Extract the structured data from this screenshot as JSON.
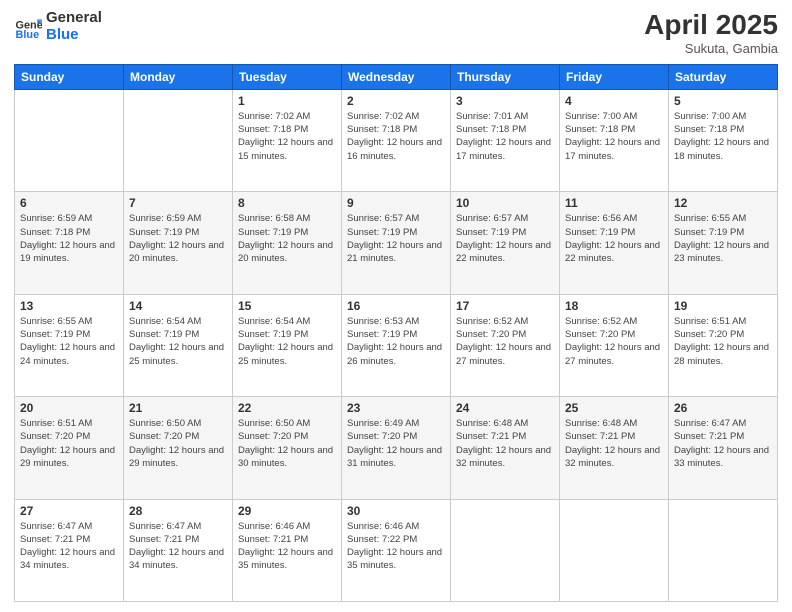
{
  "header": {
    "logo_general": "General",
    "logo_blue": "Blue",
    "month": "April 2025",
    "location": "Sukuta, Gambia"
  },
  "days_of_week": [
    "Sunday",
    "Monday",
    "Tuesday",
    "Wednesday",
    "Thursday",
    "Friday",
    "Saturday"
  ],
  "weeks": [
    [
      {
        "num": "",
        "info": ""
      },
      {
        "num": "",
        "info": ""
      },
      {
        "num": "1",
        "info": "Sunrise: 7:02 AM\nSunset: 7:18 PM\nDaylight: 12 hours and 15 minutes."
      },
      {
        "num": "2",
        "info": "Sunrise: 7:02 AM\nSunset: 7:18 PM\nDaylight: 12 hours and 16 minutes."
      },
      {
        "num": "3",
        "info": "Sunrise: 7:01 AM\nSunset: 7:18 PM\nDaylight: 12 hours and 17 minutes."
      },
      {
        "num": "4",
        "info": "Sunrise: 7:00 AM\nSunset: 7:18 PM\nDaylight: 12 hours and 17 minutes."
      },
      {
        "num": "5",
        "info": "Sunrise: 7:00 AM\nSunset: 7:18 PM\nDaylight: 12 hours and 18 minutes."
      }
    ],
    [
      {
        "num": "6",
        "info": "Sunrise: 6:59 AM\nSunset: 7:18 PM\nDaylight: 12 hours and 19 minutes."
      },
      {
        "num": "7",
        "info": "Sunrise: 6:59 AM\nSunset: 7:19 PM\nDaylight: 12 hours and 20 minutes."
      },
      {
        "num": "8",
        "info": "Sunrise: 6:58 AM\nSunset: 7:19 PM\nDaylight: 12 hours and 20 minutes."
      },
      {
        "num": "9",
        "info": "Sunrise: 6:57 AM\nSunset: 7:19 PM\nDaylight: 12 hours and 21 minutes."
      },
      {
        "num": "10",
        "info": "Sunrise: 6:57 AM\nSunset: 7:19 PM\nDaylight: 12 hours and 22 minutes."
      },
      {
        "num": "11",
        "info": "Sunrise: 6:56 AM\nSunset: 7:19 PM\nDaylight: 12 hours and 22 minutes."
      },
      {
        "num": "12",
        "info": "Sunrise: 6:55 AM\nSunset: 7:19 PM\nDaylight: 12 hours and 23 minutes."
      }
    ],
    [
      {
        "num": "13",
        "info": "Sunrise: 6:55 AM\nSunset: 7:19 PM\nDaylight: 12 hours and 24 minutes."
      },
      {
        "num": "14",
        "info": "Sunrise: 6:54 AM\nSunset: 7:19 PM\nDaylight: 12 hours and 25 minutes."
      },
      {
        "num": "15",
        "info": "Sunrise: 6:54 AM\nSunset: 7:19 PM\nDaylight: 12 hours and 25 minutes."
      },
      {
        "num": "16",
        "info": "Sunrise: 6:53 AM\nSunset: 7:19 PM\nDaylight: 12 hours and 26 minutes."
      },
      {
        "num": "17",
        "info": "Sunrise: 6:52 AM\nSunset: 7:20 PM\nDaylight: 12 hours and 27 minutes."
      },
      {
        "num": "18",
        "info": "Sunrise: 6:52 AM\nSunset: 7:20 PM\nDaylight: 12 hours and 27 minutes."
      },
      {
        "num": "19",
        "info": "Sunrise: 6:51 AM\nSunset: 7:20 PM\nDaylight: 12 hours and 28 minutes."
      }
    ],
    [
      {
        "num": "20",
        "info": "Sunrise: 6:51 AM\nSunset: 7:20 PM\nDaylight: 12 hours and 29 minutes."
      },
      {
        "num": "21",
        "info": "Sunrise: 6:50 AM\nSunset: 7:20 PM\nDaylight: 12 hours and 29 minutes."
      },
      {
        "num": "22",
        "info": "Sunrise: 6:50 AM\nSunset: 7:20 PM\nDaylight: 12 hours and 30 minutes."
      },
      {
        "num": "23",
        "info": "Sunrise: 6:49 AM\nSunset: 7:20 PM\nDaylight: 12 hours and 31 minutes."
      },
      {
        "num": "24",
        "info": "Sunrise: 6:48 AM\nSunset: 7:21 PM\nDaylight: 12 hours and 32 minutes."
      },
      {
        "num": "25",
        "info": "Sunrise: 6:48 AM\nSunset: 7:21 PM\nDaylight: 12 hours and 32 minutes."
      },
      {
        "num": "26",
        "info": "Sunrise: 6:47 AM\nSunset: 7:21 PM\nDaylight: 12 hours and 33 minutes."
      }
    ],
    [
      {
        "num": "27",
        "info": "Sunrise: 6:47 AM\nSunset: 7:21 PM\nDaylight: 12 hours and 34 minutes."
      },
      {
        "num": "28",
        "info": "Sunrise: 6:47 AM\nSunset: 7:21 PM\nDaylight: 12 hours and 34 minutes."
      },
      {
        "num": "29",
        "info": "Sunrise: 6:46 AM\nSunset: 7:21 PM\nDaylight: 12 hours and 35 minutes."
      },
      {
        "num": "30",
        "info": "Sunrise: 6:46 AM\nSunset: 7:22 PM\nDaylight: 12 hours and 35 minutes."
      },
      {
        "num": "",
        "info": ""
      },
      {
        "num": "",
        "info": ""
      },
      {
        "num": "",
        "info": ""
      }
    ]
  ]
}
